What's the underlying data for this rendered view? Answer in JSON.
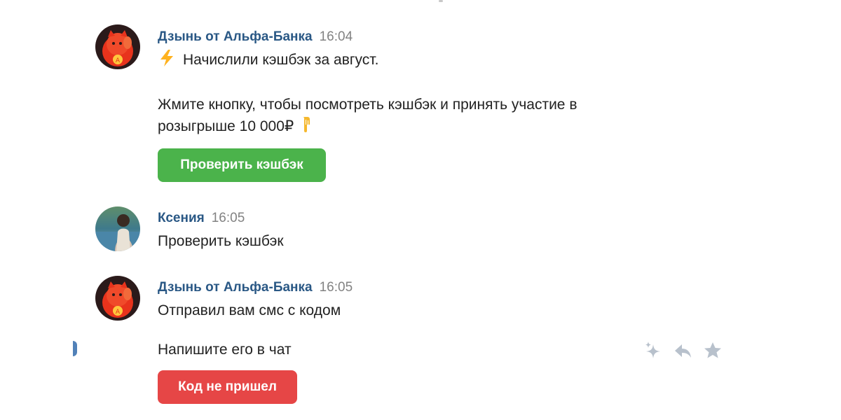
{
  "messages": [
    {
      "sender": "Дзынь от Альфа-Банка",
      "time": "16:04",
      "line1": "Начислили кэшбэк за август.",
      "line2": "Жмите кнопку, чтобы посмотреть кэшбэк и принять участие в",
      "line3": "розыгрыше 10 000₽",
      "button": "Проверить кэшбэк",
      "icons": [
        "lightning-emoji-icon",
        "pointing-down-emoji-icon"
      ]
    },
    {
      "sender": "Ксения",
      "time": "16:05",
      "line1": "Проверить кэшбэк"
    },
    {
      "sender": "Дзынь от Альфа-Банка",
      "time": "16:05",
      "line1": "Отправил вам смс с кодом",
      "line2": "Напишите его в чат",
      "button": "Код не пришел"
    }
  ],
  "message_actions": [
    "sparkle-icon",
    "reply-icon",
    "star-icon"
  ],
  "colors": {
    "sender_name": "#2a5885",
    "time": "#828282",
    "button_green": "#4bb34b",
    "button_red": "#e64646",
    "action_icons": "#b8c1cc"
  }
}
